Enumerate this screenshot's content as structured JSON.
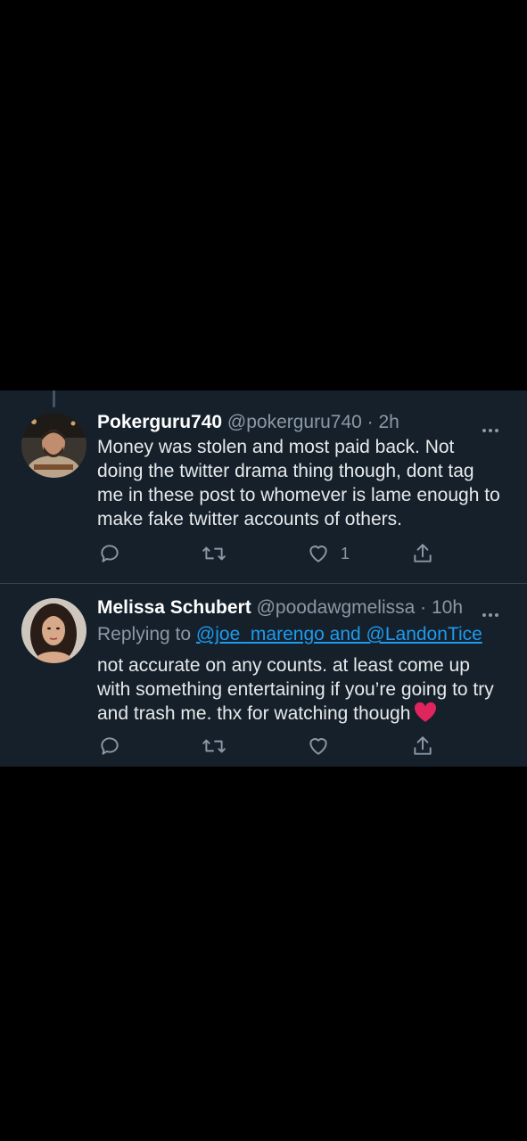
{
  "tweets": [
    {
      "name": "Pokerguru740",
      "handle_time": "@pokerguru740 · 2h",
      "lines": [
        "Money was stolen and most paid back. Not",
        "doing the twitter drama thing though, dont tag",
        "me in these post to whomever is lame enough to",
        "make fake twitter accounts of others."
      ],
      "like_count": "1"
    },
    {
      "name": "Melissa Schubert",
      "handle_time": "@poodawgmelissa · 10h",
      "replying_prefix": "Replying to ",
      "replying_mentions": "@joe_marengo and @LandonTice",
      "lines": [
        "not accurate on any counts. at least come up",
        "with something entertaining if you’re going to try",
        "and trash me. thx for watching though"
      ],
      "like_count": ""
    }
  ],
  "icons": {
    "reply": "reply-icon",
    "retweet": "retweet-icon",
    "like": "like-icon",
    "share": "share-icon",
    "more": "more-icon"
  },
  "colors": {
    "background": "#15202b",
    "page": "#000000",
    "secondary_text": "#8b98a5",
    "link": "#1d9bf0",
    "heart_emoji": "#e0245e"
  }
}
